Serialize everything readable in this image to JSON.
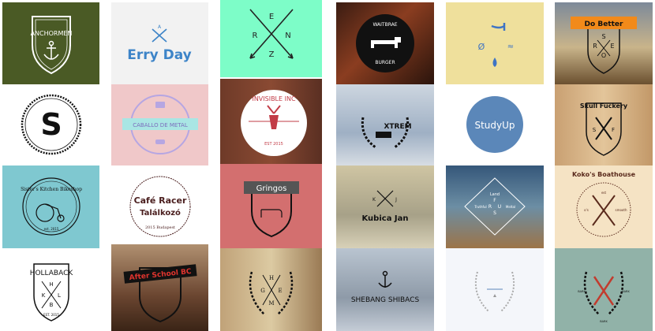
{
  "logos": {
    "anchormen": "ANCHORMEN",
    "errydayTop": "A",
    "erryday": "Erry Day",
    "renzR": "R",
    "renzE": "E",
    "renzN": "N",
    "renzZ": "Z",
    "waitbrae": "WAITBRAE",
    "burger": "BURGER",
    "doBetter": "Do Better",
    "sreoS": "S",
    "sreoR": "R",
    "sreoE": "E",
    "sreoO": "O",
    "sLetter": "S",
    "caballo": "CABALLO DE METAL",
    "invisibleInc": "INVISIBLE INC",
    "invisibleEst": "EST 2015",
    "xtrem": "XTREM",
    "studyUp": "StudyUp",
    "skullFuckery": "Skull Fuckery",
    "skullS": "S",
    "skullF": "F",
    "sistersKitchen": "Sister's Kitchen Bikeshop",
    "sistersEst": "est. 2015",
    "cafeRacer": "Café Racer",
    "talalkozo": "Találkozó",
    "budapest": "2015 Budapest",
    "gringos": "Gringos",
    "kubicaJan": "Kubica Jan",
    "kubicaK": "K",
    "kubicaJ": "J",
    "landTop": "Land",
    "landLeft": "Truthful",
    "landR": "R",
    "landU": "U",
    "landS": "S",
    "landRight": "Meltal",
    "landF": "F",
    "kokos": "Koko's Boathouse",
    "kokoLeft": "o's",
    "kokoRight": "smooth",
    "kokoSub": "est",
    "hollaback": "HOLLABACK",
    "hollaH": "H",
    "hollaL": "L",
    "hollaK": "K",
    "hollaB": "B",
    "hollaEst": "EST. 2015",
    "afterSchool": "After School BC",
    "hemG": "G",
    "hemH": "H",
    "hemE": "E",
    "hemM": "M",
    "shebang": "SHEBANG SHIBACS",
    "axeLeft": "BARK",
    "axeRight": "BARK",
    "axeBottom": "BARK"
  },
  "colors": {
    "olive": "#4a5a25",
    "lightGray": "#f2f2f2",
    "mint": "#7dfdc8",
    "teal": "#7fc8d0",
    "pink": "#f0c8c9",
    "coral": "#d36f6f",
    "blue": "#5b87b9",
    "cream": "#f5e3c4",
    "sage": "#91b2a8"
  }
}
